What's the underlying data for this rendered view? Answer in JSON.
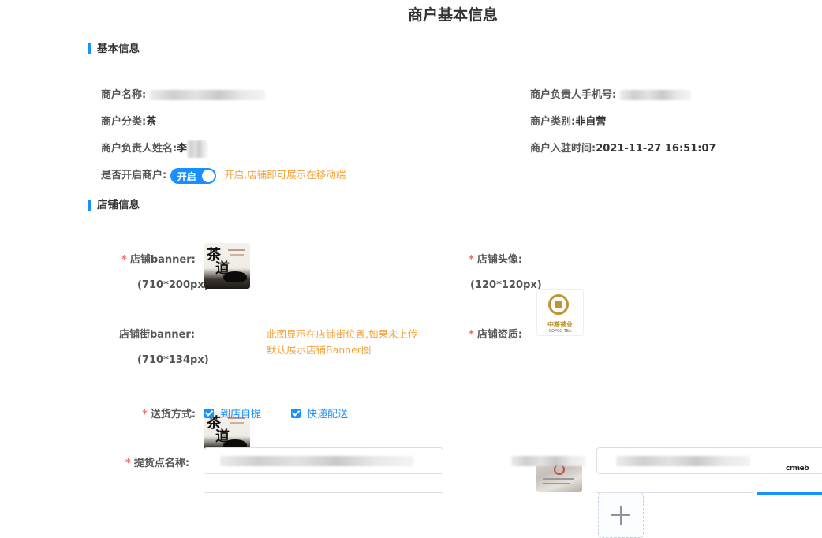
{
  "page": {
    "title": "商户基本信息"
  },
  "basic": {
    "section_title": "基本信息",
    "merchant_name_label": "商户名称:",
    "owner_phone_label": "商户负责人手机号:",
    "category_label": "商户分类:",
    "category_value": "茶",
    "type_label": "商户类别:",
    "type_value": "非自营",
    "owner_name_label": "商户负责人姓名:",
    "owner_name_value": "李",
    "join_time_label": "商户入驻时间:",
    "join_time_value": "2021-11-27 16:51:07",
    "enable_label": "是否开启商户:",
    "switch_text": "开启",
    "switch_on": true,
    "enable_hint": "开启,店铺即可展示在移动端"
  },
  "store": {
    "section_title": "店铺信息",
    "banner_label": "店铺banner:",
    "banner_size": "(710*200px)",
    "avatar_label": "店铺头像:",
    "avatar_size": "(120*120px)",
    "avatar_logo_name": "中粮茶业",
    "avatar_logo_en": "COFCO TEA",
    "street_banner_label": "店铺街banner:",
    "street_banner_size": "(710*134px)",
    "street_banner_hint_1": "此图显示在店铺街位置,如果未上传",
    "street_banner_hint_2": "默认展示店铺Banner图",
    "qualification_label": "店铺资质:",
    "delivery_label": "送货方式:",
    "delivery_options": [
      {
        "label": "到店自提",
        "checked": true
      },
      {
        "label": "快递配送",
        "checked": true
      }
    ],
    "pickup_name_label": "提货点名称:"
  },
  "icons": {
    "tea_banner": "tea-calligraphy-image",
    "upload": "plus-icon",
    "checkbox": "checkmark-icon"
  },
  "colors": {
    "accent": "#1890ff",
    "hint": "#f3a23c",
    "required": "#f56c6c"
  },
  "watermark": "crmeb"
}
